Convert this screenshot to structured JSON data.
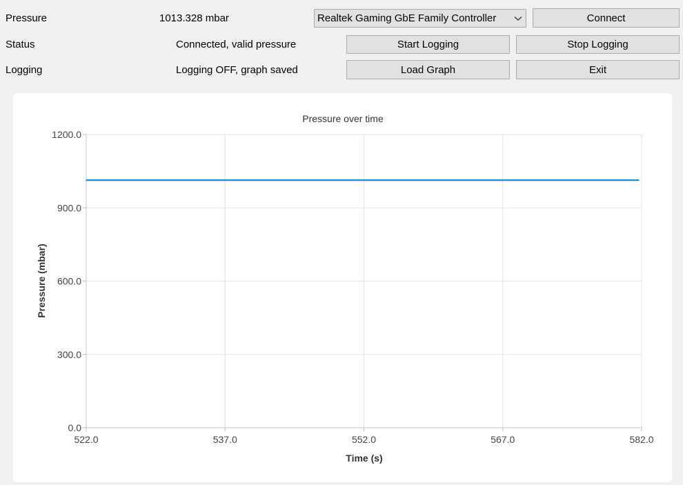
{
  "rows": {
    "pressure": {
      "label": "Pressure",
      "value": "1013.328 mbar"
    },
    "status": {
      "label": "Status",
      "value": "Connected, valid pressure"
    },
    "logging": {
      "label": "Logging",
      "value": "Logging OFF, graph saved"
    }
  },
  "adapter": {
    "selected": "Realtek Gaming GbE Family Controller"
  },
  "buttons": {
    "connect": "Connect",
    "start_logging": "Start Logging",
    "stop_logging": "Stop Logging",
    "load_graph": "Load Graph",
    "exit": "Exit"
  },
  "icons": {
    "combo_arrow": "chevron-down-icon"
  },
  "chart_data": {
    "type": "line",
    "title": "Pressure over time",
    "xlabel": "Time (s)",
    "ylabel": "Pressure (mbar)",
    "xlim": [
      522.0,
      582.0
    ],
    "ylim": [
      0.0,
      1200.0
    ],
    "xticks": [
      "522.0",
      "537.0",
      "552.0",
      "567.0",
      "582.0"
    ],
    "yticks": [
      "1200.0",
      "900.0",
      "600.0",
      "300.0",
      "0.0"
    ],
    "grid": true,
    "line_color": "#1f8ad6",
    "series": [
      {
        "x": [
          522.0,
          537.0,
          552.0,
          567.0,
          581.7
        ],
        "y": [
          1013.3,
          1013.3,
          1013.3,
          1013.3,
          1013.3
        ]
      }
    ]
  }
}
